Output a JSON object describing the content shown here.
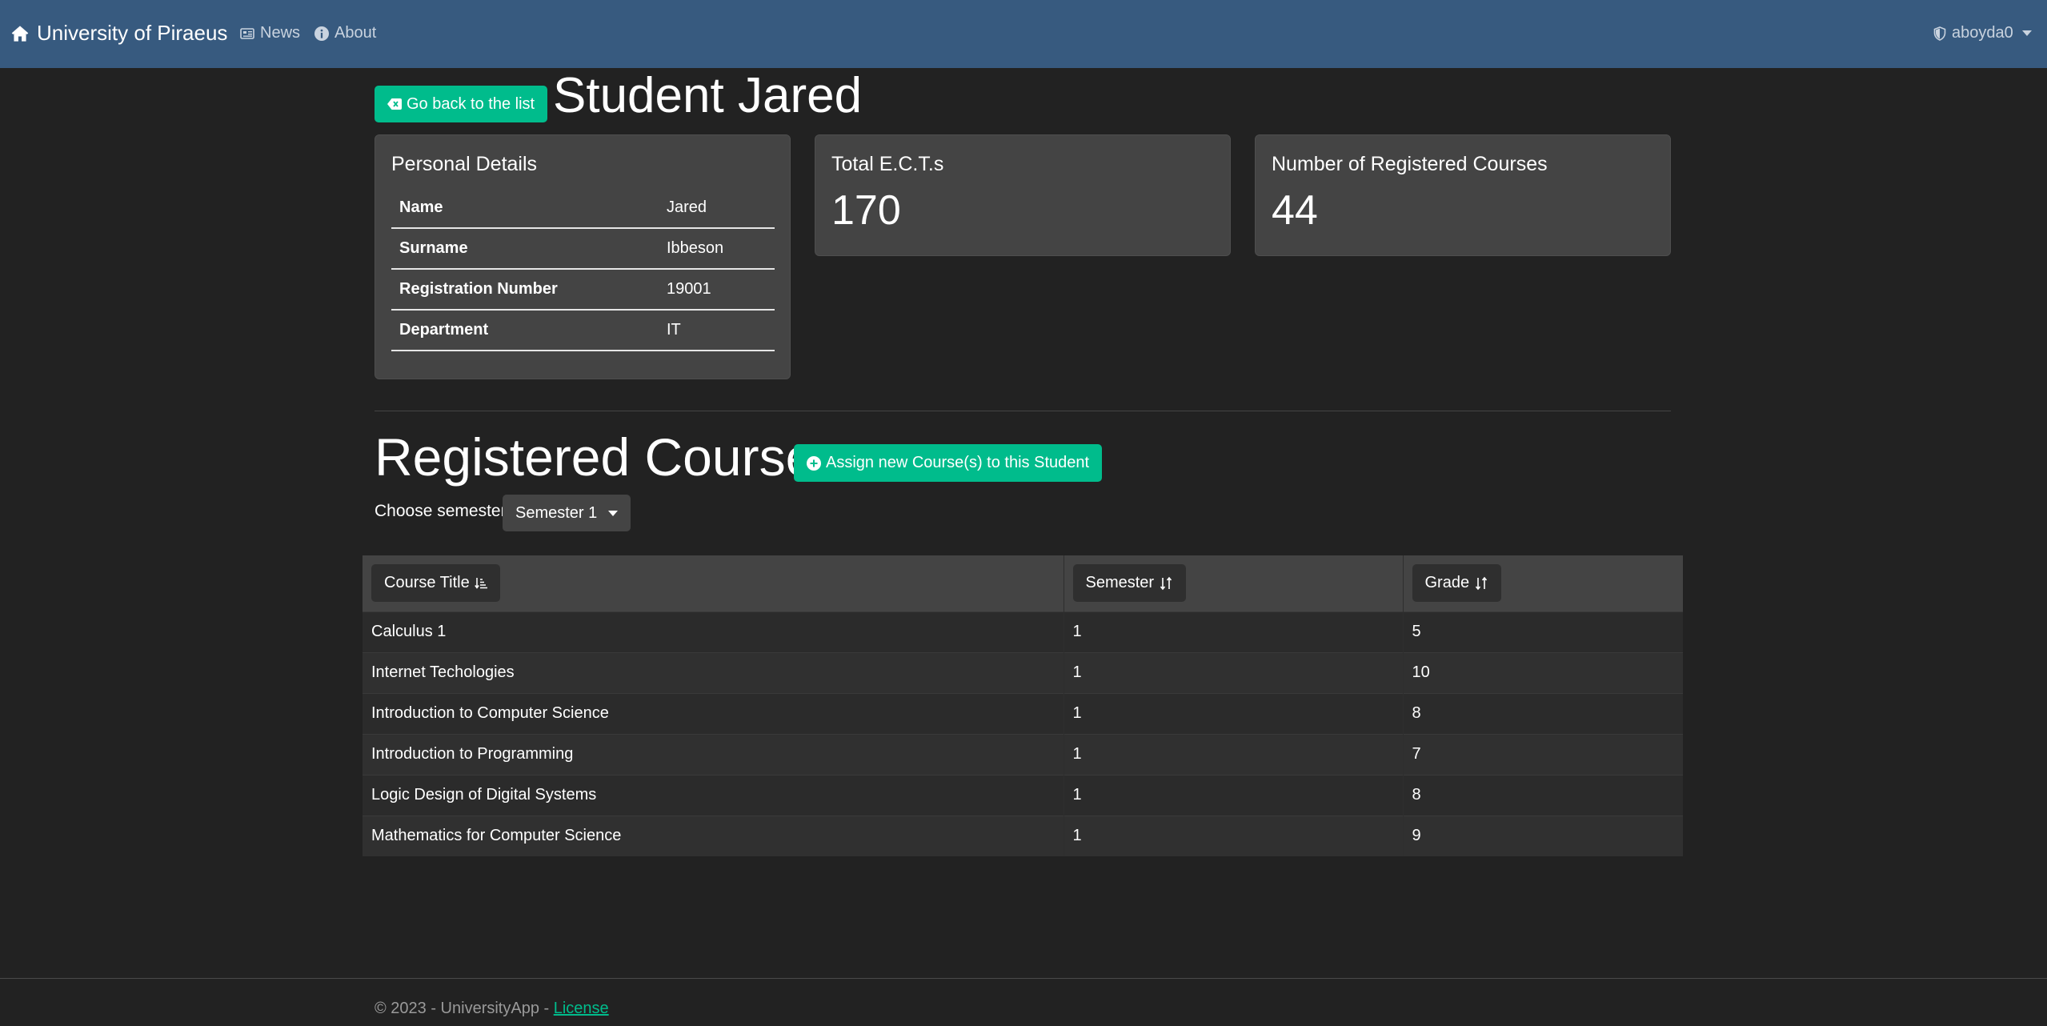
{
  "navbar": {
    "brand": "University of Piraeus",
    "news": "News",
    "about": "About",
    "user": "aboyda0"
  },
  "header": {
    "back_label": "Go back to the list",
    "title": "Student Jared"
  },
  "personal": {
    "title": "Personal Details",
    "rows": [
      {
        "key": "Name",
        "value": "Jared"
      },
      {
        "key": "Surname",
        "value": "Ibbeson"
      },
      {
        "key": "Registration Number",
        "value": "19001"
      },
      {
        "key": "Department",
        "value": "IT"
      }
    ]
  },
  "ects": {
    "title": "Total E.C.T.s",
    "value": "170"
  },
  "course_count": {
    "title": "Number of Registered Courses",
    "value": "44"
  },
  "registered": {
    "title": "Registered Courses",
    "assign_label": "Assign new Course(s) to this Student",
    "choose_label": "Choose semester:",
    "semester_selected": "Semester 1"
  },
  "table": {
    "headers": [
      "Course Title",
      "Semester",
      "Grade"
    ],
    "rows": [
      [
        "Calculus 1",
        "1",
        "5"
      ],
      [
        "Internet Techologies",
        "1",
        "10"
      ],
      [
        "Introduction to Computer Science",
        "1",
        "8"
      ],
      [
        "Introduction to Programming",
        "1",
        "7"
      ],
      [
        "Logic Design of Digital Systems",
        "1",
        "8"
      ],
      [
        "Mathematics for Computer Science",
        "1",
        "9"
      ]
    ]
  },
  "footer": {
    "text": "© 2023 - UniversityApp - ",
    "link": "License"
  },
  "colors": {
    "navbar": "#375a7f",
    "success": "#00bc8c",
    "background": "#222222",
    "card": "#444444"
  },
  "icons": [
    "home-icon",
    "newspaper-icon",
    "info-icon",
    "shield-icon",
    "backspace-icon",
    "plus-circle-icon",
    "sort-alpha-icon",
    "sort-icon"
  ]
}
